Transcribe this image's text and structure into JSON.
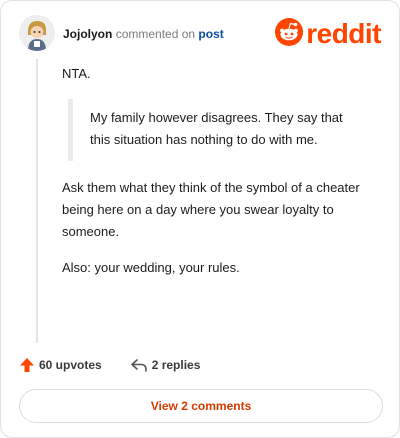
{
  "header": {
    "author": "Jojolyon",
    "action_text": "commented on",
    "post_link": "post",
    "logo_text": "reddit",
    "logo_icon": "reddit-snoo-icon",
    "avatar_icon": "user-avatar"
  },
  "comment": {
    "paragraph_1": "NTA.",
    "quote": "My family however disagrees. They say that this situation has nothing to do with me.",
    "paragraph_2": "Ask them what they think of the symbol of a cheater being here on a day where you swear loyalty to someone.",
    "paragraph_3": "Also: your wedding, your rules."
  },
  "footer": {
    "upvotes_label": "60 upvotes",
    "upvote_icon": "arrow-up-icon",
    "replies_label": "2 replies",
    "reply_icon": "reply-arrow-icon",
    "view_comments_label": "View 2 comments"
  },
  "colors": {
    "brand": "#ff4500",
    "link": "#0a4ea3",
    "button_text": "#d93a00"
  }
}
